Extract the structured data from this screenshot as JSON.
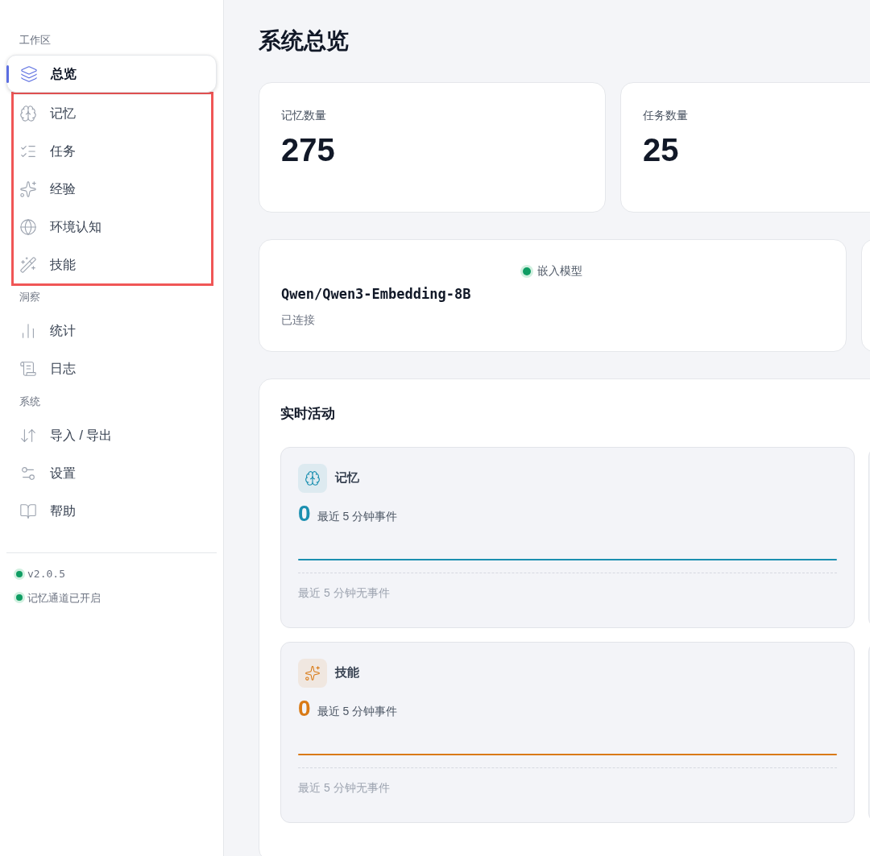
{
  "sidebar": {
    "sections": [
      {
        "title": "工作区",
        "items": [
          {
            "label": "总览",
            "selected": true,
            "framed": false
          },
          {
            "label": "记忆",
            "selected": false,
            "framed": true
          },
          {
            "label": "任务",
            "selected": false,
            "framed": true
          },
          {
            "label": "经验",
            "selected": false,
            "framed": true
          },
          {
            "label": "环境认知",
            "selected": false,
            "framed": true
          },
          {
            "label": "技能",
            "selected": false,
            "framed": true
          }
        ]
      },
      {
        "title": "洞察",
        "items": [
          {
            "label": "统计",
            "selected": false,
            "framed": false
          },
          {
            "label": "日志",
            "selected": false,
            "framed": false
          }
        ]
      },
      {
        "title": "系统",
        "items": [
          {
            "label": "导入 / 导出",
            "selected": false,
            "framed": false
          },
          {
            "label": "设置",
            "selected": false,
            "framed": false
          },
          {
            "label": "帮助",
            "selected": false,
            "framed": false
          }
        ]
      }
    ],
    "status": [
      {
        "text": "v2.0.5",
        "kind": "version",
        "color": "#0f9d63"
      },
      {
        "text": "记忆通道已开启",
        "kind": "channel",
        "color": "#0f9d63"
      }
    ]
  },
  "page_title": "系统总览",
  "stats": [
    {
      "label": "记忆数量",
      "value": "275"
    },
    {
      "label": "任务数量",
      "value": "25"
    }
  ],
  "model": {
    "label": "嵌入模型",
    "color": "#0f9d63",
    "name": "Qwen/Qwen3-Embedding-8B",
    "state": "已连接"
  },
  "activity": {
    "title": "实时活动",
    "cards": [
      {
        "kind": "memory",
        "title": "记忆",
        "color": "#1b8fb0",
        "count": "0",
        "caption": "最近 5 分钟事件",
        "empty": "最近 5 分钟无事件"
      },
      {
        "kind": "skill",
        "title": "技能",
        "color": "#d97a16",
        "count": "0",
        "caption": "最近 5 分钟事件",
        "empty": "最近 5 分钟无事件"
      }
    ]
  }
}
